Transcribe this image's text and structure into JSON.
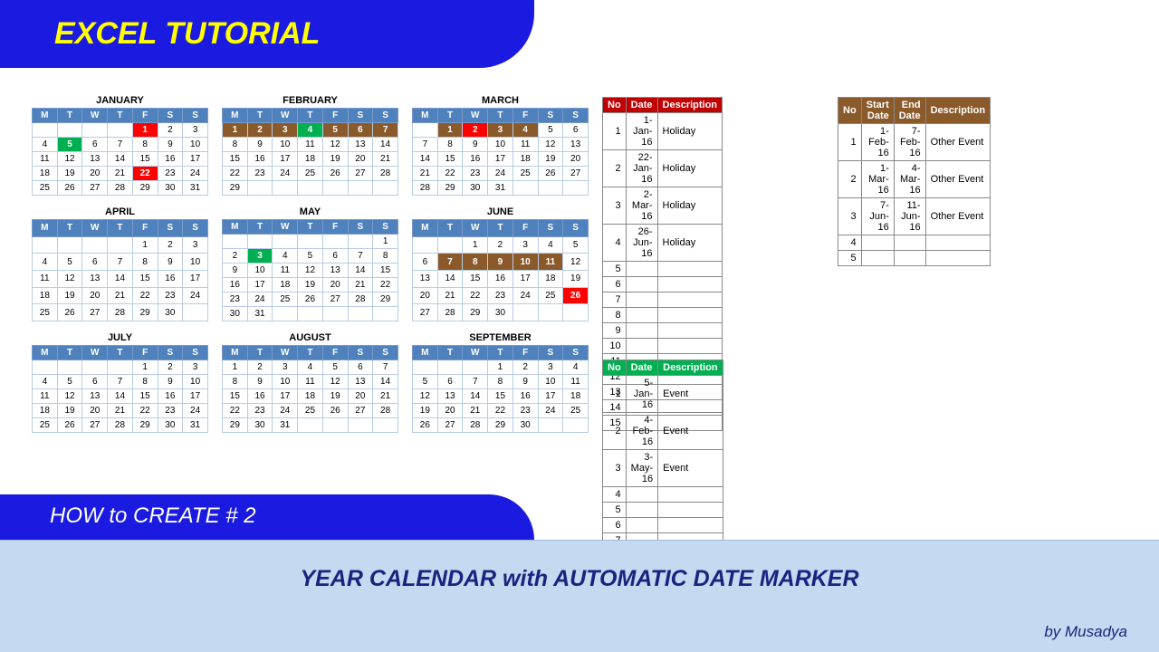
{
  "header": {
    "title": "EXCEL TUTORIAL"
  },
  "subheader": {
    "title": "HOW to CREATE # 2"
  },
  "footer": {
    "title": "YEAR CALENDAR with AUTOMATIC DATE MARKER",
    "byline": "by Musadya"
  },
  "weekdays": [
    "M",
    "T",
    "W",
    "T",
    "F",
    "S",
    "S"
  ],
  "months": [
    {
      "name": "JANUARY",
      "lead": 4,
      "days": 31,
      "marks": {
        "1": "red",
        "5": "green",
        "22": "red"
      }
    },
    {
      "name": "FEBRUARY",
      "lead": 0,
      "days": 29,
      "marks": {
        "1": "brown",
        "2": "brown",
        "3": "brown",
        "4": "green",
        "5": "brown",
        "6": "brown",
        "7": "brown"
      }
    },
    {
      "name": "MARCH",
      "lead": 1,
      "days": 31,
      "marks": {
        "1": "brown",
        "2": "red",
        "3": "brown",
        "4": "brown"
      }
    },
    {
      "name": "APRIL",
      "lead": 4,
      "days": 30,
      "marks": {}
    },
    {
      "name": "MAY",
      "lead": 6,
      "days": 31,
      "marks": {
        "3": "green"
      }
    },
    {
      "name": "JUNE",
      "lead": 2,
      "days": 30,
      "marks": {
        "7": "brown",
        "8": "brown",
        "9": "brown",
        "10": "brown",
        "11": "brown",
        "26": "red"
      }
    },
    {
      "name": "JULY",
      "lead": 4,
      "days": 31,
      "marks": {}
    },
    {
      "name": "AUGUST",
      "lead": 0,
      "days": 31,
      "marks": {}
    },
    {
      "name": "SEPTEMBER",
      "lead": 3,
      "days": 30,
      "marks": {}
    }
  ],
  "tables": {
    "holidays": {
      "headers": [
        "No",
        "Date",
        "Description"
      ],
      "total_rows": 15,
      "rows": [
        {
          "no": 1,
          "date": "1-Jan-16",
          "desc": "Holiday"
        },
        {
          "no": 2,
          "date": "22-Jan-16",
          "desc": "Holiday"
        },
        {
          "no": 3,
          "date": "2-Mar-16",
          "desc": "Holiday"
        },
        {
          "no": 4,
          "date": "26-Jun-16",
          "desc": "Holiday"
        }
      ]
    },
    "ranges": {
      "headers": [
        "No",
        "Start Date",
        "End Date",
        "Description"
      ],
      "total_rows": 5,
      "rows": [
        {
          "no": 1,
          "start": "1-Feb-16",
          "end": "7-Feb-16",
          "desc": "Other Event"
        },
        {
          "no": 2,
          "start": "1-Mar-16",
          "end": "4-Mar-16",
          "desc": "Other Event"
        },
        {
          "no": 3,
          "start": "7-Jun-16",
          "end": "11-Jun-16",
          "desc": "Other Event"
        }
      ]
    },
    "events": {
      "headers": [
        "No",
        "Date",
        "Description"
      ],
      "total_rows": 9,
      "rows": [
        {
          "no": 1,
          "date": "5-Jan-16",
          "desc": "Event"
        },
        {
          "no": 2,
          "date": "4-Feb-16",
          "desc": "Event"
        },
        {
          "no": 3,
          "date": "3-May-16",
          "desc": "Event"
        }
      ]
    }
  }
}
